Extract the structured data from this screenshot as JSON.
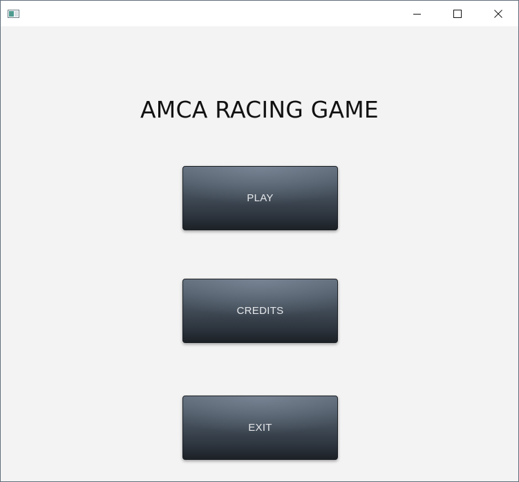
{
  "window": {
    "title": "",
    "controls": {
      "minimize_icon": "minimize-icon",
      "maximize_icon": "maximize-icon",
      "close_icon": "close-icon"
    }
  },
  "main": {
    "title": "AMCA RACING GAME",
    "buttons": {
      "play": "PLAY",
      "credits": "CREDITS",
      "exit": "EXIT"
    }
  },
  "colors": {
    "background": "#f3f3f3",
    "button_top": "#5e6a78",
    "button_bottom": "#1c2127",
    "button_text": "#e6e8ea"
  }
}
